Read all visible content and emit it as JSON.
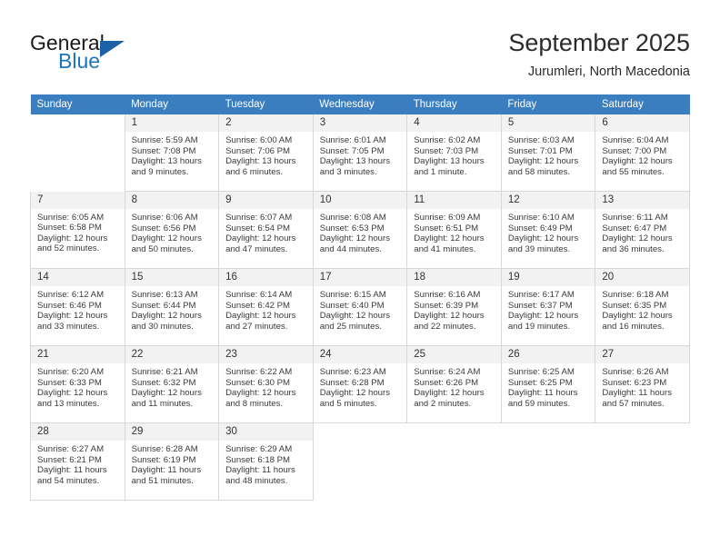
{
  "brand": {
    "name_part1": "General",
    "name_part2": "Blue",
    "accent_color": "#1b75bb",
    "triangle_color": "#1b61a8"
  },
  "header": {
    "title": "September 2025",
    "subtitle": "Jurumleri, North Macedonia"
  },
  "calendar": {
    "header_bg": "#3a7ebf",
    "daynum_bg": "#f2f2f2",
    "weekday_headers": [
      "Sunday",
      "Monday",
      "Tuesday",
      "Wednesday",
      "Thursday",
      "Friday",
      "Saturday"
    ],
    "weeks": [
      [
        {
          "day": "",
          "sunrise": "",
          "sunset": "",
          "daylight": "",
          "empty": true
        },
        {
          "day": "1",
          "sunrise": "Sunrise: 5:59 AM",
          "sunset": "Sunset: 7:08 PM",
          "daylight": "Daylight: 13 hours and 9 minutes."
        },
        {
          "day": "2",
          "sunrise": "Sunrise: 6:00 AM",
          "sunset": "Sunset: 7:06 PM",
          "daylight": "Daylight: 13 hours and 6 minutes."
        },
        {
          "day": "3",
          "sunrise": "Sunrise: 6:01 AM",
          "sunset": "Sunset: 7:05 PM",
          "daylight": "Daylight: 13 hours and 3 minutes."
        },
        {
          "day": "4",
          "sunrise": "Sunrise: 6:02 AM",
          "sunset": "Sunset: 7:03 PM",
          "daylight": "Daylight: 13 hours and 1 minute."
        },
        {
          "day": "5",
          "sunrise": "Sunrise: 6:03 AM",
          "sunset": "Sunset: 7:01 PM",
          "daylight": "Daylight: 12 hours and 58 minutes."
        },
        {
          "day": "6",
          "sunrise": "Sunrise: 6:04 AM",
          "sunset": "Sunset: 7:00 PM",
          "daylight": "Daylight: 12 hours and 55 minutes."
        }
      ],
      [
        {
          "day": "7",
          "sunrise": "Sunrise: 6:05 AM",
          "sunset": "Sunset: 6:58 PM",
          "daylight": "Daylight: 12 hours and 52 minutes."
        },
        {
          "day": "8",
          "sunrise": "Sunrise: 6:06 AM",
          "sunset": "Sunset: 6:56 PM",
          "daylight": "Daylight: 12 hours and 50 minutes."
        },
        {
          "day": "9",
          "sunrise": "Sunrise: 6:07 AM",
          "sunset": "Sunset: 6:54 PM",
          "daylight": "Daylight: 12 hours and 47 minutes."
        },
        {
          "day": "10",
          "sunrise": "Sunrise: 6:08 AM",
          "sunset": "Sunset: 6:53 PM",
          "daylight": "Daylight: 12 hours and 44 minutes."
        },
        {
          "day": "11",
          "sunrise": "Sunrise: 6:09 AM",
          "sunset": "Sunset: 6:51 PM",
          "daylight": "Daylight: 12 hours and 41 minutes."
        },
        {
          "day": "12",
          "sunrise": "Sunrise: 6:10 AM",
          "sunset": "Sunset: 6:49 PM",
          "daylight": "Daylight: 12 hours and 39 minutes."
        },
        {
          "day": "13",
          "sunrise": "Sunrise: 6:11 AM",
          "sunset": "Sunset: 6:47 PM",
          "daylight": "Daylight: 12 hours and 36 minutes."
        }
      ],
      [
        {
          "day": "14",
          "sunrise": "Sunrise: 6:12 AM",
          "sunset": "Sunset: 6:46 PM",
          "daylight": "Daylight: 12 hours and 33 minutes."
        },
        {
          "day": "15",
          "sunrise": "Sunrise: 6:13 AM",
          "sunset": "Sunset: 6:44 PM",
          "daylight": "Daylight: 12 hours and 30 minutes."
        },
        {
          "day": "16",
          "sunrise": "Sunrise: 6:14 AM",
          "sunset": "Sunset: 6:42 PM",
          "daylight": "Daylight: 12 hours and 27 minutes."
        },
        {
          "day": "17",
          "sunrise": "Sunrise: 6:15 AM",
          "sunset": "Sunset: 6:40 PM",
          "daylight": "Daylight: 12 hours and 25 minutes."
        },
        {
          "day": "18",
          "sunrise": "Sunrise: 6:16 AM",
          "sunset": "Sunset: 6:39 PM",
          "daylight": "Daylight: 12 hours and 22 minutes."
        },
        {
          "day": "19",
          "sunrise": "Sunrise: 6:17 AM",
          "sunset": "Sunset: 6:37 PM",
          "daylight": "Daylight: 12 hours and 19 minutes."
        },
        {
          "day": "20",
          "sunrise": "Sunrise: 6:18 AM",
          "sunset": "Sunset: 6:35 PM",
          "daylight": "Daylight: 12 hours and 16 minutes."
        }
      ],
      [
        {
          "day": "21",
          "sunrise": "Sunrise: 6:20 AM",
          "sunset": "Sunset: 6:33 PM",
          "daylight": "Daylight: 12 hours and 13 minutes."
        },
        {
          "day": "22",
          "sunrise": "Sunrise: 6:21 AM",
          "sunset": "Sunset: 6:32 PM",
          "daylight": "Daylight: 12 hours and 11 minutes."
        },
        {
          "day": "23",
          "sunrise": "Sunrise: 6:22 AM",
          "sunset": "Sunset: 6:30 PM",
          "daylight": "Daylight: 12 hours and 8 minutes."
        },
        {
          "day": "24",
          "sunrise": "Sunrise: 6:23 AM",
          "sunset": "Sunset: 6:28 PM",
          "daylight": "Daylight: 12 hours and 5 minutes."
        },
        {
          "day": "25",
          "sunrise": "Sunrise: 6:24 AM",
          "sunset": "Sunset: 6:26 PM",
          "daylight": "Daylight: 12 hours and 2 minutes."
        },
        {
          "day": "26",
          "sunrise": "Sunrise: 6:25 AM",
          "sunset": "Sunset: 6:25 PM",
          "daylight": "Daylight: 11 hours and 59 minutes."
        },
        {
          "day": "27",
          "sunrise": "Sunrise: 6:26 AM",
          "sunset": "Sunset: 6:23 PM",
          "daylight": "Daylight: 11 hours and 57 minutes."
        }
      ],
      [
        {
          "day": "28",
          "sunrise": "Sunrise: 6:27 AM",
          "sunset": "Sunset: 6:21 PM",
          "daylight": "Daylight: 11 hours and 54 minutes."
        },
        {
          "day": "29",
          "sunrise": "Sunrise: 6:28 AM",
          "sunset": "Sunset: 6:19 PM",
          "daylight": "Daylight: 11 hours and 51 minutes."
        },
        {
          "day": "30",
          "sunrise": "Sunrise: 6:29 AM",
          "sunset": "Sunset: 6:18 PM",
          "daylight": "Daylight: 11 hours and 48 minutes."
        },
        {
          "day": "",
          "sunrise": "",
          "sunset": "",
          "daylight": "",
          "empty": true
        },
        {
          "day": "",
          "sunrise": "",
          "sunset": "",
          "daylight": "",
          "empty": true
        },
        {
          "day": "",
          "sunrise": "",
          "sunset": "",
          "daylight": "",
          "empty": true
        },
        {
          "day": "",
          "sunrise": "",
          "sunset": "",
          "daylight": "",
          "empty": true
        }
      ]
    ]
  }
}
